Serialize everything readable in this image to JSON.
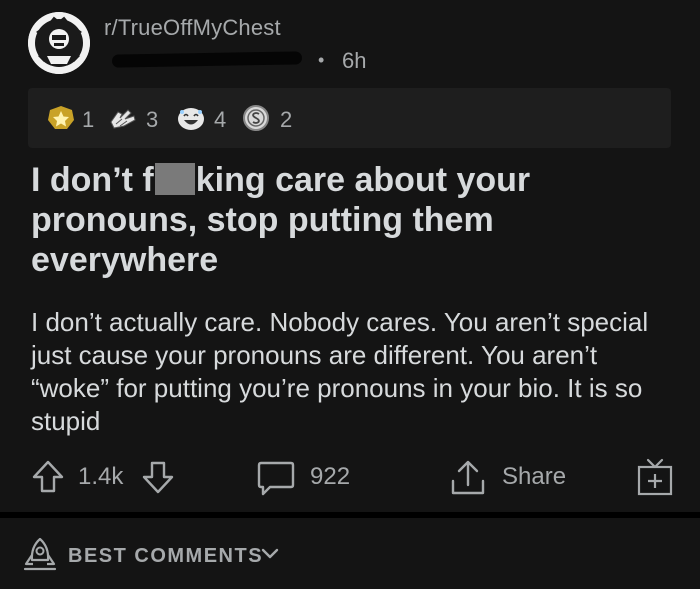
{
  "post": {
    "subreddit": "r/TrueOffMyChest",
    "age": "6h",
    "awards": [
      {
        "icon": "gold-star-award-icon",
        "count": "1"
      },
      {
        "icon": "wholesome-hands-award-icon",
        "count": "3"
      },
      {
        "icon": "laughing-face-award-icon",
        "count": "4"
      },
      {
        "icon": "silver-coin-award-icon",
        "count": "2"
      }
    ],
    "title_start": "I don’t f",
    "title_end": "king care about your pronouns, stop putting them everywhere",
    "body": "I don’t actually care. Nobody cares. You aren’t special just cause your pronouns are different. You aren’t “woke” for putting you’re pronouns in your bio. It is so stupid"
  },
  "actions": {
    "score": "1.4k",
    "comments": "922",
    "share": "Share"
  },
  "comments_sort": {
    "label": "BEST COMMENTS"
  },
  "colors": {
    "background": "#141414",
    "text": "#d7dadc",
    "muted": "#a6a9ab",
    "award_bar": "#1e1e1e"
  }
}
